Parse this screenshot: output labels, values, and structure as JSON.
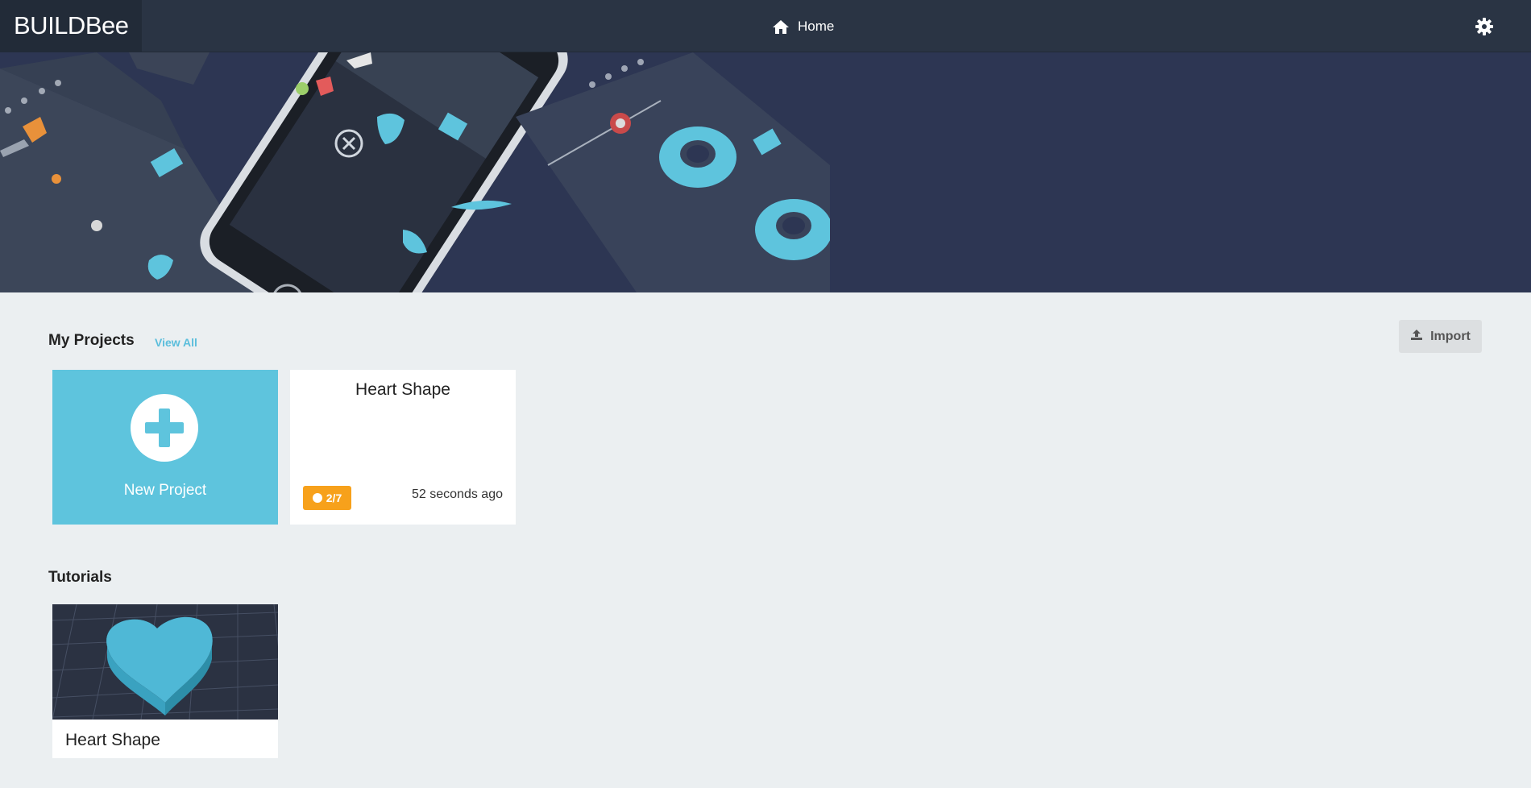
{
  "header": {
    "logo_build": "BUILD",
    "logo_bee": "Bee",
    "nav_home_label": "Home"
  },
  "projects": {
    "section_title": "My Projects",
    "view_all_label": "View All",
    "import_label": "Import",
    "new_project_label": "New Project",
    "items": [
      {
        "title": "Heart Shape",
        "badge": "2/7",
        "updated": "52 seconds ago"
      }
    ]
  },
  "tutorials": {
    "section_title": "Tutorials",
    "items": [
      {
        "title": "Heart Shape"
      }
    ]
  },
  "colors": {
    "topbar": "#2a3444",
    "hero": "#2d3653",
    "accent": "#5ec4dd",
    "badge": "#f7a11b",
    "page_bg": "#ebeff1"
  },
  "icons": {
    "home": "home-icon",
    "settings": "gear-icon",
    "import": "upload-icon",
    "new_project": "plus-icon"
  }
}
